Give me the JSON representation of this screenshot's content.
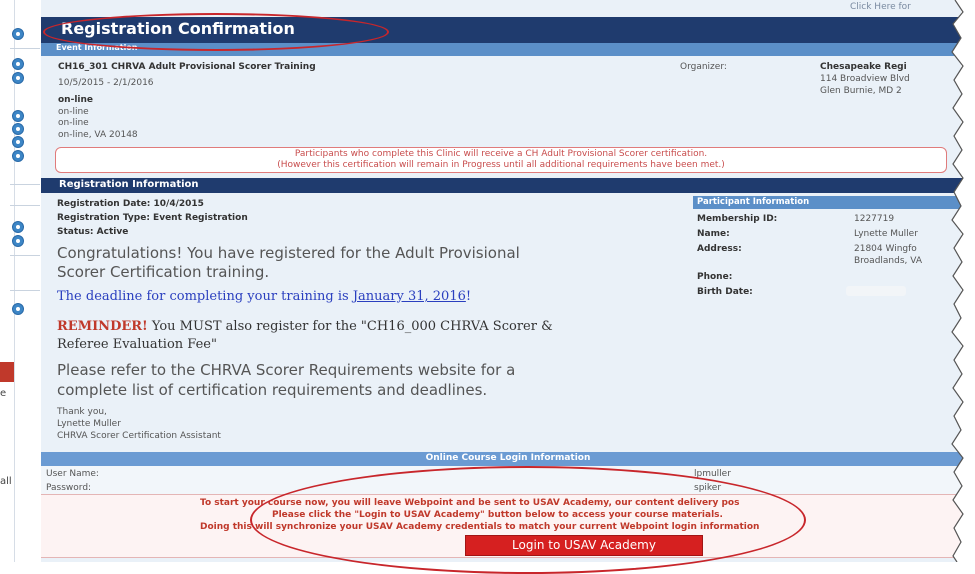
{
  "header": {
    "click_here": "Click Here for",
    "title": "Registration Confirmation",
    "event_info_label": "Event Information"
  },
  "event": {
    "name": "CH16_301 CHRVA Adult Provisional Scorer Training",
    "dates": "10/5/2015 - 2/1/2016",
    "location_title": "on-line",
    "location_line1": "on-line",
    "location_line2": "on-line",
    "location_line3": "on-line, VA  20148",
    "organizer_label": "Organizer:",
    "organizer_name": "Chesapeake Regi",
    "organizer_addr1": "114 Broadview Blvd",
    "organizer_addr2": "Glen Burnie, MD  2"
  },
  "notice": {
    "line1": "Participants who complete this Clinic will receive a CH Adult Provisional Scorer certification.",
    "line2": "(However this certification will remain in Progress until all additional requirements have been met.)"
  },
  "registration": {
    "section_label": "Registration Information",
    "date": "Registration Date: 10/4/2015",
    "type": "Registration Type: Event Registration",
    "status": "Status: Active",
    "congrats_line1": "Congratulations! You have registered for the Adult Provisional",
    "congrats_line2": "Scorer Certification training.",
    "deadline_prefix": "The deadline for completing your training is ",
    "deadline_date": "January 31, 2016",
    "deadline_suffix": "!",
    "reminder_label": "REMINDER!",
    "reminder_text1": " You MUST also register for the \"CH16_000 CHRVA Scorer &",
    "reminder_text2": "Referee Evaluation Fee\"",
    "refer_line1": "Please refer to the CHRVA Scorer Requirements website for a",
    "refer_line2": "complete list of certification requirements and deadlines.",
    "thanks": "Thank you,",
    "signer_name": "Lynette Muller",
    "signer_title": "CHRVA Scorer Certification Assistant"
  },
  "participant": {
    "section_label": "Participant Information",
    "membership_label": "Membership ID:",
    "membership_value": "1227719",
    "name_label": "Name:",
    "name_value": "Lynette Muller",
    "address_label": "Address:",
    "address_line1": "21804 Wingfo",
    "address_line2": "Broadlands, VA",
    "phone_label": "Phone:",
    "birth_label": "Birth Date:"
  },
  "online_course": {
    "section_label": "Online Course Login Information",
    "username_label": "User Name:",
    "username_value": "lpmuller",
    "password_label": "Password:",
    "password_value": "spiker",
    "info_line1": "To start your course now, you will leave Webpoint and be sent to USAV Academy, our content delivery pos",
    "info_line2": "Please click the \"Login to USAV Academy\" button below to access your course materials.",
    "info_line3": "Doing this will synchronize your USAV Academy credentials to match your current Webpoint login information",
    "login_button": "Login to USAV Academy"
  },
  "left_edge": {
    "char1": "e",
    "char2": "all"
  },
  "colors": {
    "title_bar": "#1f3b6e",
    "sub_bar": "#5b8fc8",
    "notice_text": "#c84d4d",
    "button": "#d62020",
    "annotation": "#c8262b"
  }
}
